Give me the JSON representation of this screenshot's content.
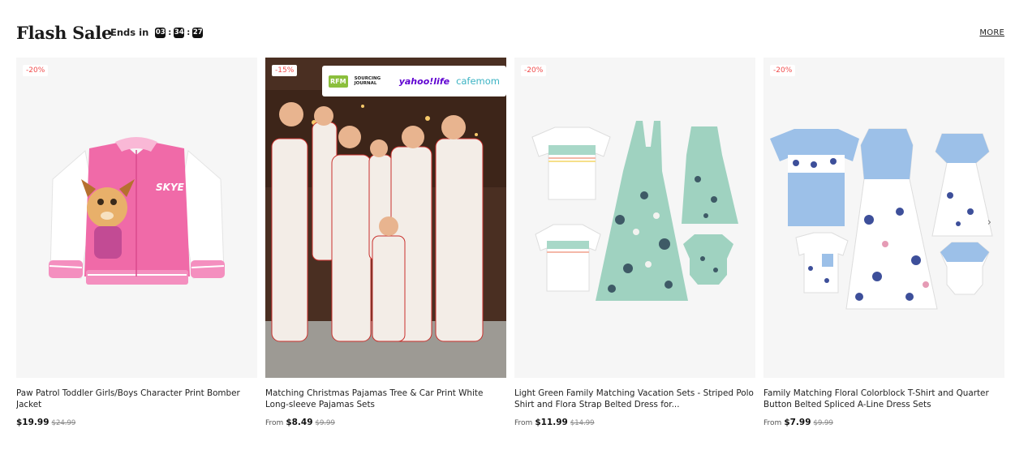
{
  "header": {
    "title": "Flash Sale",
    "ends_label": "Ends in",
    "timer": {
      "hours": "03",
      "minutes": "34",
      "seconds": "27"
    },
    "more_label": "MORE"
  },
  "products": [
    {
      "badge": "-20%",
      "name": "Paw Patrol Toddler Girls/Boys Character Print Bomber Jacket",
      "from_label": "",
      "price": "$19.99",
      "original_price": "$24.99"
    },
    {
      "badge": "-15%",
      "name": "Matching Christmas Pajamas Tree & Car Print White Long-sleeve Pajamas Sets",
      "from_label": "From",
      "price": "$8.49",
      "original_price": "$9.99",
      "media_logos": {
        "rfm": "RFM",
        "sourcing": "SOURCING JOURNAL",
        "yahoo": "yahoo!life",
        "cafemom": "cafemom"
      }
    },
    {
      "badge": "-20%",
      "name": "Light Green Family Matching Vacation Sets - Striped Polo Shirt and Flora Strap Belted Dress for...",
      "from_label": "From",
      "price": "$11.99",
      "original_price": "$14.99"
    },
    {
      "badge": "-20%",
      "name": "Family Matching Floral Colorblock T-Shirt and Quarter Button Belted Spliced A-Line Dress Sets",
      "from_label": "From",
      "price": "$7.99",
      "original_price": "$9.99"
    }
  ],
  "skye_text": "SKYE",
  "icons": {
    "next": "chevron-right-icon"
  },
  "colors": {
    "badge": "#f04a4a",
    "jacket_pink": "#f06aa8",
    "mint": "#a8d8c8",
    "blue": "#9cc0e8"
  }
}
